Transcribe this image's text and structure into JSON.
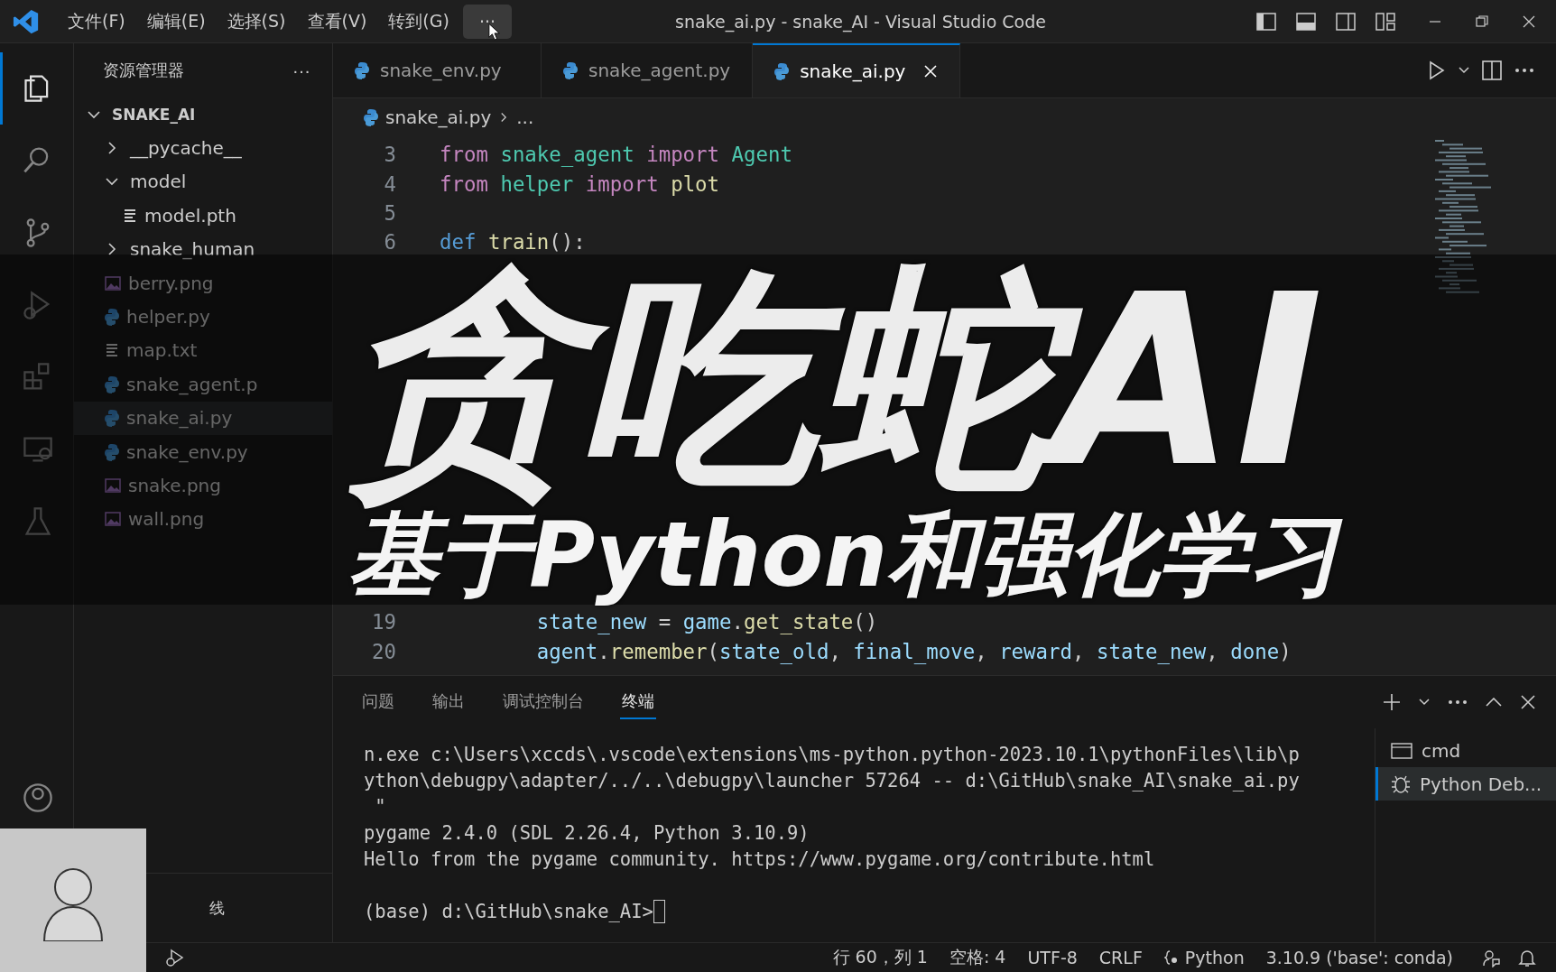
{
  "title_bar": {
    "menus": [
      {
        "label": "文件(F)",
        "hovered": false
      },
      {
        "label": "编辑(E)",
        "hovered": false
      },
      {
        "label": "选择(S)",
        "hovered": false
      },
      {
        "label": "查看(V)",
        "hovered": false
      },
      {
        "label": "转到(G)",
        "hovered": false
      },
      {
        "label": "···",
        "hovered": true
      }
    ],
    "title": "snake_ai.py - snake_AI - Visual Studio Code"
  },
  "activity_bar": {
    "items": [
      {
        "kind": "files",
        "selected": true
      },
      {
        "kind": "search",
        "selected": false
      },
      {
        "kind": "source-control",
        "selected": false
      },
      {
        "kind": "run-debug",
        "selected": false
      },
      {
        "kind": "extensions",
        "selected": false
      },
      {
        "kind": "remote",
        "selected": false
      },
      {
        "kind": "testing",
        "selected": false
      }
    ],
    "bottom": [
      {
        "kind": "account",
        "selected": false
      }
    ]
  },
  "sidebar": {
    "title": "资源管理器",
    "more": "···",
    "tree": [
      {
        "label": "SNAKE_AI",
        "kind": "root",
        "expanded": true,
        "selected": false,
        "children": [
          {
            "label": "__pycache__",
            "kind": "folder",
            "expanded": false,
            "selected": false
          },
          {
            "label": "model",
            "kind": "folder",
            "expanded": true,
            "selected": false,
            "children": [
              {
                "label": "model.pth",
                "kind": "text",
                "selected": false
              }
            ]
          },
          {
            "label": "snake_human",
            "kind": "folder",
            "expanded": false,
            "selected": false
          },
          {
            "label": "berry.png",
            "kind": "image",
            "selected": false
          },
          {
            "label": "helper.py",
            "kind": "python",
            "selected": false
          },
          {
            "label": "map.txt",
            "kind": "text",
            "selected": false
          },
          {
            "label": "snake_agent.p",
            "kind": "python",
            "selected": false
          },
          {
            "label": "snake_ai.py",
            "kind": "python",
            "selected": true
          },
          {
            "label": "snake_env.py",
            "kind": "python",
            "selected": false
          },
          {
            "label": "snake.png",
            "kind": "image",
            "selected": false
          },
          {
            "label": "wall.png",
            "kind": "image",
            "selected": false
          }
        ]
      }
    ],
    "timeline_title": "线"
  },
  "editor": {
    "tabs": [
      {
        "label": "snake_env.py",
        "selected": false
      },
      {
        "label": "snake_agent.py",
        "selected": false
      },
      {
        "label": "snake_ai.py",
        "selected": true
      }
    ],
    "breadcrumb": [
      "snake_ai.py",
      "..."
    ],
    "lines": [
      {
        "number": "3",
        "tokens": [
          {
            "text": "from ",
            "kind": "control"
          },
          {
            "text": "snake_agent ",
            "kind": "class"
          },
          {
            "text": "import ",
            "kind": "control"
          },
          {
            "text": "Agent",
            "kind": "class"
          }
        ]
      },
      {
        "number": "4",
        "tokens": [
          {
            "text": "from ",
            "kind": "control"
          },
          {
            "text": "helper ",
            "kind": "class"
          },
          {
            "text": "import ",
            "kind": "control"
          },
          {
            "text": "plot",
            "kind": "func"
          }
        ]
      },
      {
        "number": "5"
      },
      {
        "number": "6",
        "tokens": [
          {
            "text": "def ",
            "kind": "def"
          },
          {
            "text": "train",
            "kind": "func"
          },
          {
            "text": "():",
            "kind": "plain"
          }
        ]
      },
      {
        "number": "19",
        "tokens": [
          {
            "text": "        state_new",
            "kind": "var"
          },
          {
            "text": " = ",
            "kind": "plain"
          },
          {
            "text": "game",
            "kind": "var"
          },
          {
            "text": ".",
            "kind": "plain"
          },
          {
            "text": "get_state",
            "kind": "func"
          },
          {
            "text": "()",
            "kind": "plain"
          }
        ]
      },
      {
        "number": "20",
        "tokens": [
          {
            "text": "        agent",
            "kind": "var"
          },
          {
            "text": ".",
            "kind": "plain"
          },
          {
            "text": "remember",
            "kind": "func"
          },
          {
            "text": "(",
            "kind": "plain"
          },
          {
            "text": "state_old",
            "kind": "var"
          },
          {
            "text": ", ",
            "kind": "plain"
          },
          {
            "text": "final_move",
            "kind": "var"
          },
          {
            "text": ", ",
            "kind": "plain"
          },
          {
            "text": "reward",
            "kind": "var"
          },
          {
            "text": ", ",
            "kind": "plain"
          },
          {
            "text": "state_new",
            "kind": "var"
          },
          {
            "text": ", ",
            "kind": "plain"
          },
          {
            "text": "done",
            "kind": "var"
          },
          {
            "text": ")",
            "kind": "plain"
          }
        ]
      }
    ]
  },
  "panel": {
    "tabs": [
      {
        "label": "问题",
        "selected": false
      },
      {
        "label": "输出",
        "selected": false
      },
      {
        "label": "调试控制台",
        "selected": false
      },
      {
        "label": "终端",
        "selected": true
      }
    ],
    "terminal_lines": [
      "n.exe c:\\Users\\xccds\\.vscode\\extensions\\ms-python.python-2023.10.1\\pythonFiles\\lib\\p",
      "ython\\debugpy\\adapter/../..\\debugpy\\launcher 57264 -- d:\\GitHub\\snake_AI\\snake_ai.py",
      " \"",
      "pygame 2.4.0 (SDL 2.26.4, Python 3.10.9)",
      "Hello from the pygame community. https://www.pygame.org/contribute.html"
    ],
    "prompt": "(base) d:\\GitHub\\snake_AI>",
    "terminals": [
      {
        "label": "cmd",
        "kind": "cmd",
        "selected": false
      },
      {
        "label": "Python Deb...",
        "kind": "debug",
        "selected": true
      }
    ]
  },
  "status_bar": {
    "items": [
      {
        "label": "行 60，列 1",
        "kind": "text"
      },
      {
        "label": "空格: 4",
        "kind": "text"
      },
      {
        "label": "UTF-8",
        "kind": "text"
      },
      {
        "label": "CRLF",
        "kind": "text"
      },
      {
        "label": "Python",
        "kind": "language"
      },
      {
        "label": "3.10.9 ('base': conda)",
        "kind": "text"
      }
    ]
  },
  "banner": {
    "title": "贪吃蛇AI",
    "subtitle": "基于Python和强化学习"
  }
}
